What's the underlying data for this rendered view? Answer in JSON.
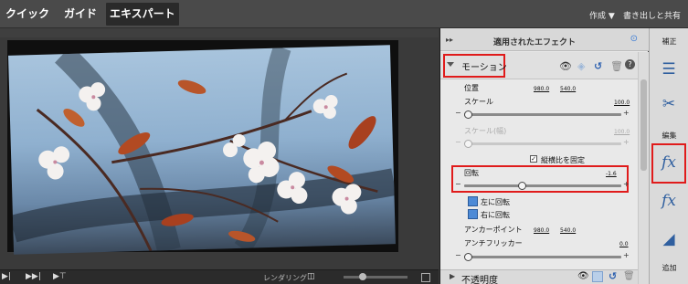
{
  "topbar": {
    "tabs": [
      {
        "label": "クイック"
      },
      {
        "label": "ガイド"
      },
      {
        "label": "エキスパート"
      }
    ],
    "create_label": "作成 ▼",
    "export_label": "書き出しと共有"
  },
  "transport": {
    "rendering_label": "レンダリング"
  },
  "panel": {
    "title": "適用されたエフェクト",
    "motion": {
      "label": "モーション",
      "position_label": "位置",
      "position_x": "980.0",
      "position_y": "540.0",
      "scale_label": "スケール",
      "scale_value": "100.0",
      "scale_width_label": "スケール(幅)",
      "scale_width_value": "100.0",
      "uniform_scale_label": "縦横比を固定",
      "uniform_scale_checked": true,
      "rotation_label": "回転",
      "rotation_value": "-1.6",
      "rotate_left_label": "左に回転",
      "rotate_right_label": "右に回転",
      "anchor_label": "アンカーポイント",
      "anchor_x": "980.0",
      "anchor_y": "540.0",
      "antiflicker_label": "アンチフリッカー",
      "antiflicker_value": "0.0"
    },
    "opacity_label": "不透明度"
  },
  "sidebar": {
    "adjust_label": "補正",
    "edit_label": "編集",
    "add_label": "追加"
  },
  "colors": {
    "highlight_red": "#e01b1b",
    "accent_blue": "#3a7bd5"
  }
}
